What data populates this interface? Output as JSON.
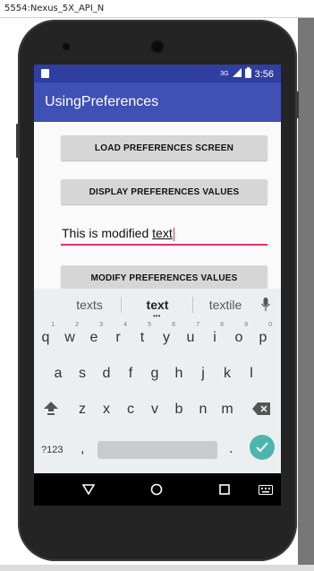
{
  "window": {
    "title": "5554:Nexus_5X_API_N"
  },
  "status_bar": {
    "network": "3G",
    "time": "3:56"
  },
  "app_bar": {
    "title": "UsingPreferences"
  },
  "buttons": {
    "load": "LOAD PREFERENCES SCREEN",
    "display": "DISPLAY PREFERENCES VALUES",
    "modify": "MODIFY PREFERENCES VALUES"
  },
  "edit_text": {
    "before": "This is modified ",
    "underlined": "text"
  },
  "keyboard": {
    "suggestions": [
      "texts",
      "text",
      "textile"
    ],
    "row1": [
      "q",
      "w",
      "e",
      "r",
      "t",
      "y",
      "u",
      "i",
      "o",
      "p"
    ],
    "row1_hints": [
      "1",
      "2",
      "3",
      "4",
      "5",
      "6",
      "7",
      "8",
      "9",
      "0"
    ],
    "row2": [
      "a",
      "s",
      "d",
      "f",
      "g",
      "h",
      "j",
      "k",
      "l"
    ],
    "row3": [
      "z",
      "x",
      "c",
      "v",
      "b",
      "n",
      "m"
    ],
    "symbols_label": "?123",
    "comma": ",",
    "period": ".",
    "icons": [
      "mic-icon",
      "shift-icon",
      "backspace-icon",
      "enter-check-icon"
    ]
  },
  "nav_bar": {
    "icons": [
      "back-icon",
      "home-icon",
      "recents-icon",
      "keyboard-icon"
    ]
  },
  "colors": {
    "primary": "#3f51b5",
    "primary_dark": "#303f9f",
    "accent": "#e0306d",
    "enter_key": "#4db6ac"
  }
}
